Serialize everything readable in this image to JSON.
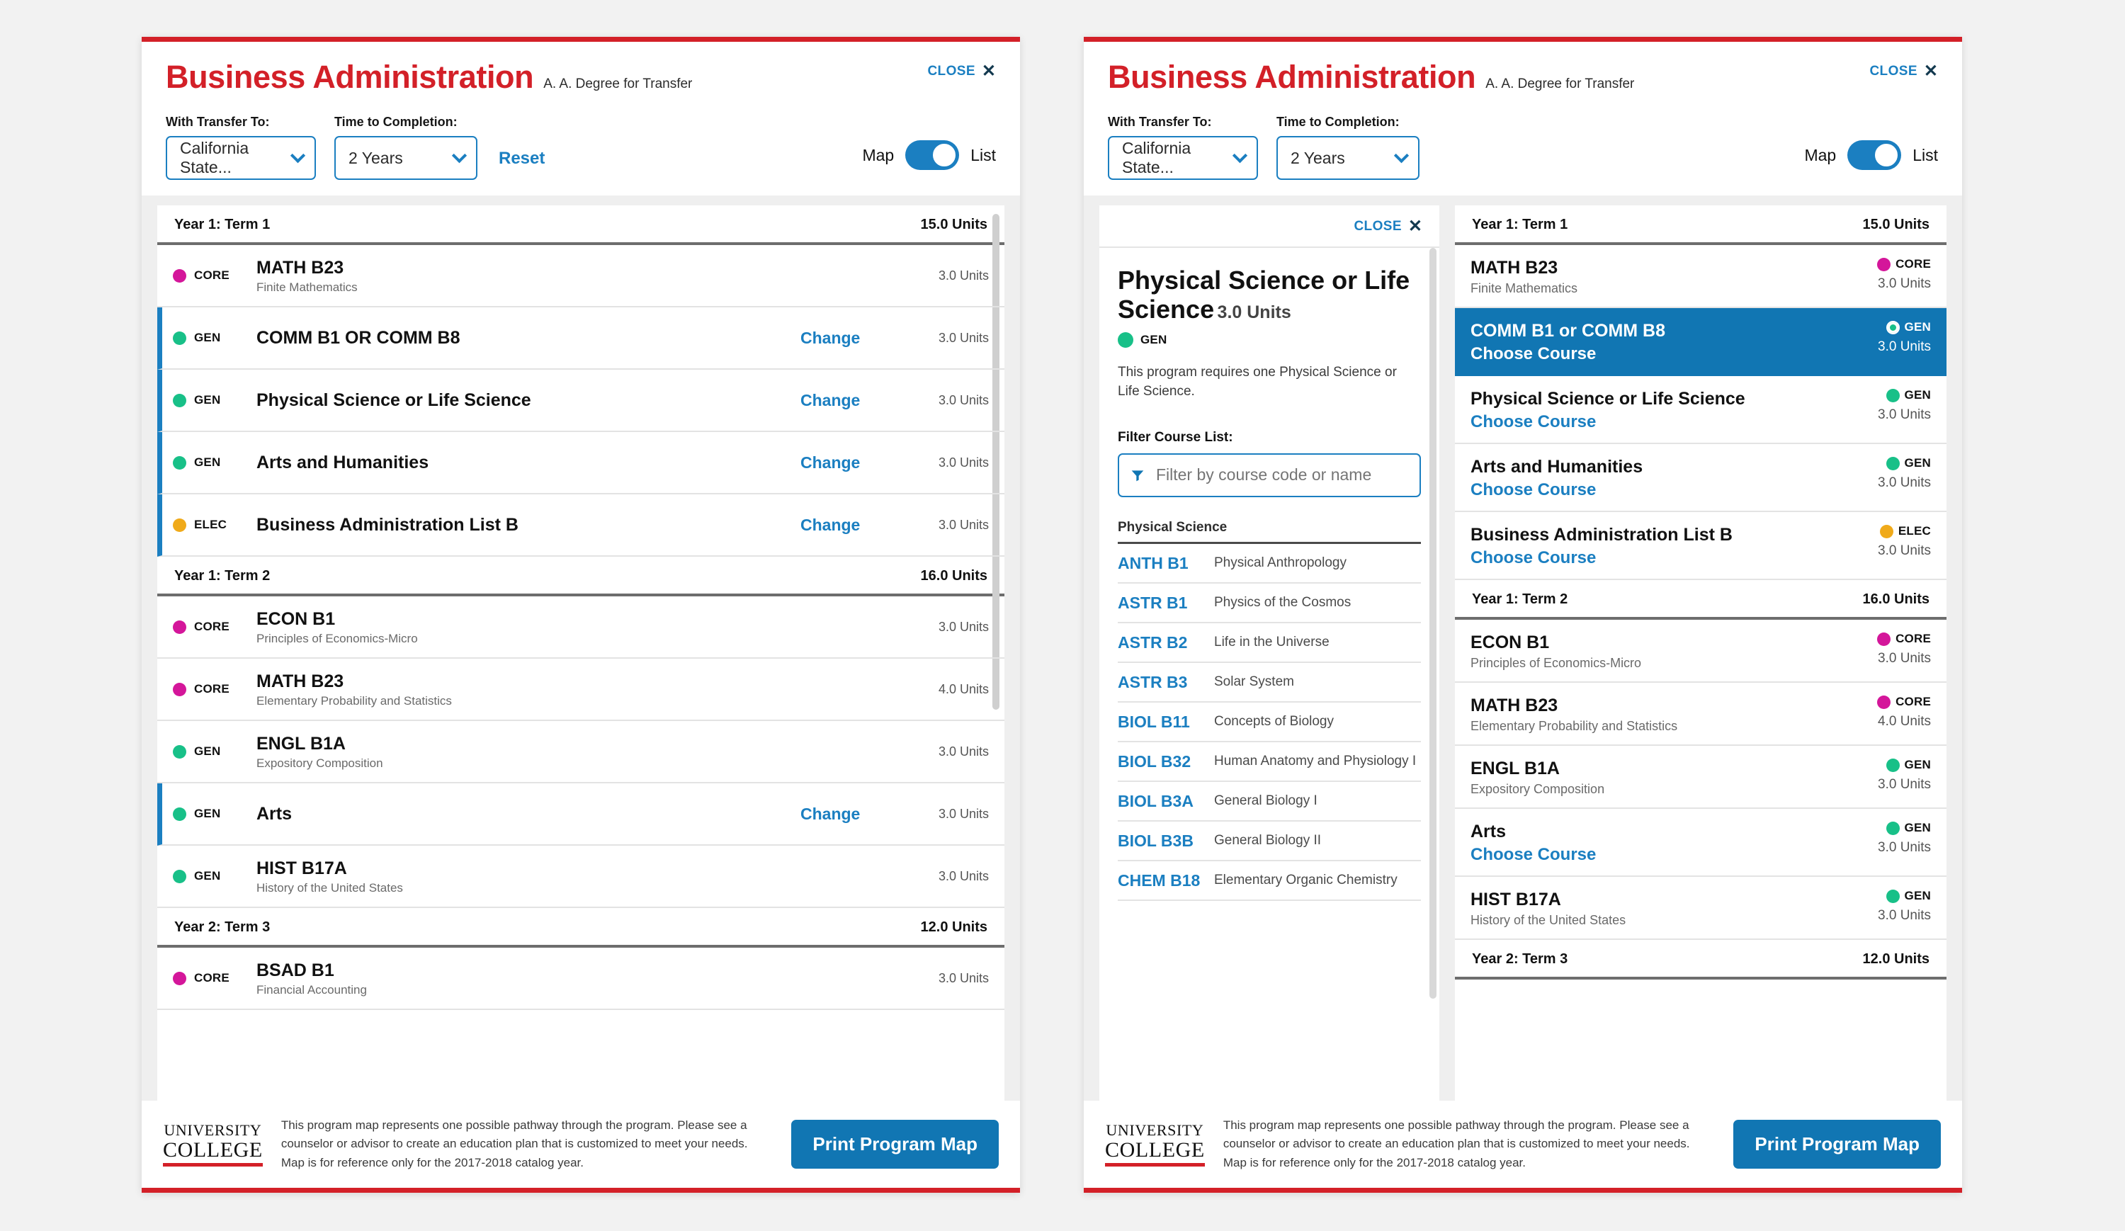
{
  "header": {
    "title": "Business Administration",
    "degree": "A. A. Degree for Transfer",
    "close_label": "CLOSE",
    "close_icon": "close-x-icon",
    "transfer_label": "With Transfer To:",
    "transfer_value": "California State...",
    "time_label": "Time to Completion:",
    "time_value": "2 Years",
    "reset_label": "Reset",
    "toggle_left": "Map",
    "toggle_right": "List"
  },
  "colors": {
    "brand_red": "#d32028",
    "link_blue": "#1b7fc1",
    "select_blue": "#1176b3",
    "core": "#d4169a",
    "gen": "#18c088",
    "elec": "#f0aa1a"
  },
  "left_panel": {
    "terms": [
      {
        "label": "Year 1: Term 1",
        "units": "15.0 Units",
        "rows": [
          {
            "badge": "CORE",
            "type": "core",
            "code": "MATH B23",
            "name": "Finite Mathematics",
            "units": "3.0 Units",
            "change": "",
            "changeable": false
          },
          {
            "badge": "GEN",
            "type": "gen",
            "code": "COMM B1 OR COMM B8",
            "name": "",
            "units": "3.0 Units",
            "change": "Change",
            "changeable": true
          },
          {
            "badge": "GEN",
            "type": "gen",
            "code": "Physical Science or Life Science",
            "name": "",
            "units": "3.0 Units",
            "change": "Change",
            "changeable": true
          },
          {
            "badge": "GEN",
            "type": "gen",
            "code": "Arts and Humanities",
            "name": "",
            "units": "3.0 Units",
            "change": "Change",
            "changeable": true
          },
          {
            "badge": "ELEC",
            "type": "elec",
            "code": "Business Administration List B",
            "name": "",
            "units": "3.0 Units",
            "change": "Change",
            "changeable": true
          }
        ]
      },
      {
        "label": "Year 1: Term 2",
        "units": "16.0 Units",
        "rows": [
          {
            "badge": "CORE",
            "type": "core",
            "code": "ECON B1",
            "name": "Principles of Economics-Micro",
            "units": "3.0 Units",
            "change": "",
            "changeable": false
          },
          {
            "badge": "CORE",
            "type": "core",
            "code": "MATH B23",
            "name": "Elementary Probability and Statistics",
            "units": "4.0 Units",
            "change": "",
            "changeable": false
          },
          {
            "badge": "GEN",
            "type": "gen",
            "code": "ENGL B1A",
            "name": "Expository Composition",
            "units": "3.0 Units",
            "change": "",
            "changeable": false
          },
          {
            "badge": "GEN",
            "type": "gen",
            "code": "Arts",
            "name": "",
            "units": "3.0 Units",
            "change": "Change",
            "changeable": true
          },
          {
            "badge": "GEN",
            "type": "gen",
            "code": "HIST B17A",
            "name": "History of the United States",
            "units": "3.0 Units",
            "change": "",
            "changeable": false
          }
        ]
      },
      {
        "label": "Year 2: Term 3",
        "units": "12.0 Units",
        "rows": [
          {
            "badge": "CORE",
            "type": "core",
            "code": "BSAD B1",
            "name": "Financial Accounting",
            "units": "3.0 Units",
            "change": "",
            "changeable": false
          }
        ]
      }
    ]
  },
  "chooser": {
    "close_label": "CLOSE",
    "title": "Physical Science or Life Science",
    "units": "3.0 Units",
    "badge": "GEN",
    "badge_type": "gen",
    "description": "This program requires one Physical Science or Life Science.",
    "filter_label": "Filter Course List:",
    "filter_placeholder": "Filter by course code or name",
    "filter_value": "",
    "filter_icon": "funnel-icon",
    "section_label": "Physical Science",
    "courses": [
      {
        "code": "ANTH B1",
        "name": "Physical Anthropology"
      },
      {
        "code": "ASTR B1",
        "name": "Physics of the Cosmos"
      },
      {
        "code": "ASTR B2",
        "name": "Life in the Universe"
      },
      {
        "code": "ASTR B3",
        "name": "Solar System"
      },
      {
        "code": "BIOL B11",
        "name": "Concepts of Biology"
      },
      {
        "code": "BIOL B32",
        "name": "Human Anatomy and Physiology I"
      },
      {
        "code": "BIOL B3A",
        "name": "General Biology I"
      },
      {
        "code": "BIOL B3B",
        "name": "General Biology II"
      },
      {
        "code": "CHEM B18",
        "name": "Elementary Organic Chemistry"
      }
    ]
  },
  "right_panel": {
    "terms": [
      {
        "label": "Year 1: Term 1",
        "units": "15.0 Units",
        "rows": [
          {
            "code": "MATH B23",
            "name": "Finite Mathematics",
            "choose": "",
            "badge": "CORE",
            "type": "core",
            "units": "3.0 Units",
            "selected": false
          },
          {
            "code": "COMM B1 or COMM B8",
            "name": "",
            "choose": "Choose Course",
            "badge": "GEN",
            "type": "gen",
            "units": "3.0 Units",
            "selected": true
          },
          {
            "code": "Physical Science or Life Science",
            "name": "",
            "choose": "Choose Course",
            "badge": "GEN",
            "type": "gen",
            "units": "3.0 Units",
            "selected": false
          },
          {
            "code": "Arts and Humanities",
            "name": "",
            "choose": "Choose Course",
            "badge": "GEN",
            "type": "gen",
            "units": "3.0 Units",
            "selected": false
          },
          {
            "code": "Business Administration List B",
            "name": "",
            "choose": "Choose Course",
            "badge": "ELEC",
            "type": "elec",
            "units": "3.0 Units",
            "selected": false
          }
        ]
      },
      {
        "label": "Year 1: Term 2",
        "units": "16.0 Units",
        "rows": [
          {
            "code": "ECON B1",
            "name": "Principles of Economics-Micro",
            "choose": "",
            "badge": "CORE",
            "type": "core",
            "units": "3.0 Units",
            "selected": false
          },
          {
            "code": "MATH B23",
            "name": "Elementary Probability and Statistics",
            "choose": "",
            "badge": "CORE",
            "type": "core",
            "units": "4.0 Units",
            "selected": false
          },
          {
            "code": "ENGL B1A",
            "name": "Expository Composition",
            "choose": "",
            "badge": "GEN",
            "type": "gen",
            "units": "3.0 Units",
            "selected": false
          },
          {
            "code": "Arts",
            "name": "",
            "choose": "Choose Course",
            "badge": "GEN",
            "type": "gen",
            "units": "3.0 Units",
            "selected": false
          },
          {
            "code": "HIST B17A",
            "name": "History of the United States",
            "choose": "",
            "badge": "GEN",
            "type": "gen",
            "units": "3.0 Units",
            "selected": false
          }
        ]
      },
      {
        "label": "Year 2: Term 3",
        "units": "12.0 Units",
        "rows": []
      }
    ]
  },
  "footer": {
    "logo_line1": "UNIVERSITY",
    "logo_line2": "COLLEGE",
    "text": "This program map represents one possible pathway through the program.  Please see a counselor or advisor to create an education plan that is customized to meet your needs. Map is for reference only for the 2017-2018 catalog year.",
    "print_label": "Print Program Map"
  }
}
